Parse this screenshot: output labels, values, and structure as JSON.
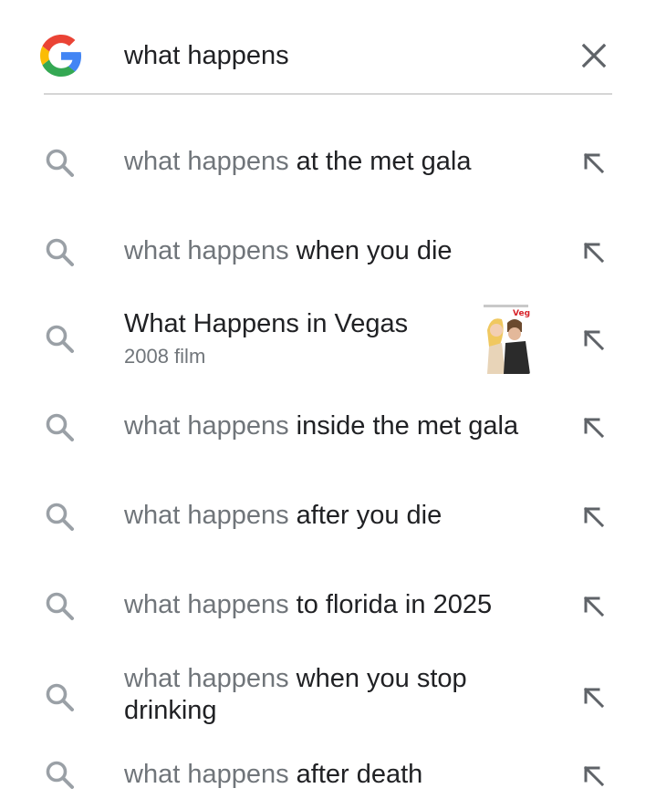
{
  "search": {
    "query": "what happens",
    "clear_icon": "close-icon",
    "logo_icon": "google-g-logo"
  },
  "suggestions": [
    {
      "prefix": "what happens",
      "rest": " at the met gala"
    },
    {
      "prefix": "what happens",
      "rest": " when you die"
    },
    {
      "title": "What Happens in Vegas",
      "subtitle": "2008 film",
      "thumbnail": "movie-poster",
      "poster_text": "Vegas"
    },
    {
      "prefix": "what happens",
      "rest": " inside the met gala"
    },
    {
      "prefix": "what happens",
      "rest": " after you die"
    },
    {
      "prefix": "what happens",
      "rest": " to florida in 2025"
    },
    {
      "prefix": "what happens",
      "rest": " when you stop drinking"
    },
    {
      "prefix": "what happens",
      "rest": " after death"
    }
  ],
  "colors": {
    "google_blue": "#4285F4",
    "google_red": "#EA4335",
    "google_yellow": "#FBBC05",
    "google_green": "#34A853",
    "icon_gray": "#9aa0a6",
    "prefix_gray": "#70757a"
  }
}
